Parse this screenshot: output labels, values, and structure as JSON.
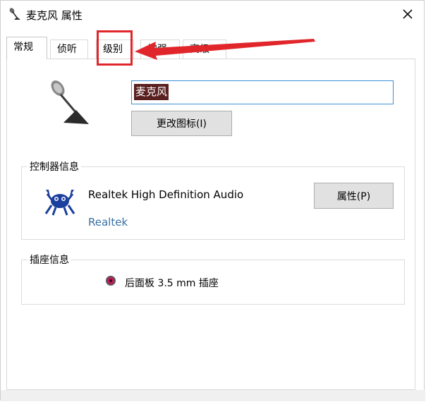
{
  "window": {
    "title": "麦克风 属性"
  },
  "tabs": [
    {
      "label": "常规",
      "active": true
    },
    {
      "label": "侦听",
      "active": false
    },
    {
      "label": "级别",
      "active": false
    },
    {
      "label": "增强",
      "active": false
    },
    {
      "label": "高级",
      "active": false
    }
  ],
  "general": {
    "device_name_value": "麦克风",
    "change_icon_label": "更改图标(I)"
  },
  "controller": {
    "group_label": "控制器信息",
    "device_name": "Realtek High Definition Audio",
    "vendor_link": "Realtek",
    "properties_label": "属性(P)"
  },
  "jack": {
    "group_label": "插座信息",
    "text": "后面板 3.5 mm 插座",
    "dot_color": "#c2185b"
  },
  "annotation": {
    "color": "#e0262b"
  },
  "icons": {
    "title": "microphone-icon",
    "close": "close-icon",
    "device": "microphone-icon",
    "logo": "realtek-crab-icon"
  }
}
